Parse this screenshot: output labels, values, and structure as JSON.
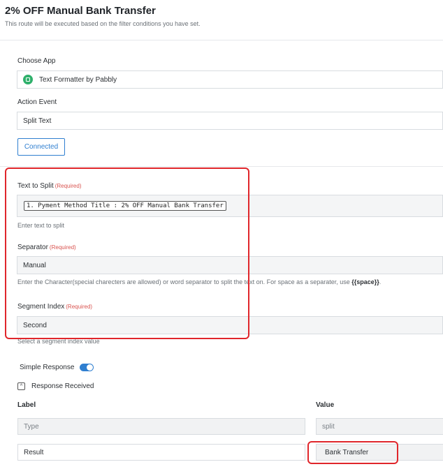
{
  "header": {
    "title": "2% OFF Manual Bank Transfer",
    "subtitle": "This route will be executed based on the filter conditions you have set."
  },
  "choose_app": {
    "label": "Choose App",
    "value": "Text Formatter by Pabbly",
    "icon": "pabbly-formatter-icon"
  },
  "action_event": {
    "label": "Action Event",
    "value": "Split Text"
  },
  "connected_button": "Connected",
  "text_to_split": {
    "label": "Text to Split",
    "required": "(Required)",
    "token": "1. Pyment Method Title : 2% OFF Manual Bank Transfer",
    "help": "Enter text to split"
  },
  "separator": {
    "label": "Separator",
    "required": "(Required)",
    "value": "Manual",
    "help_prefix": "Enter the Character(special charecters are allowed) or word separator to split the text on. For space as a separater, use ",
    "help_code": "{{space}}",
    "help_suffix": "."
  },
  "segment_index": {
    "label": "Segment Index",
    "required": "(Required)",
    "value": "Second",
    "help": "Select a segment index value"
  },
  "simple_response": {
    "label": "Simple Response",
    "enabled": true
  },
  "response_received": {
    "label": "Response Received",
    "collapse_symbol": "^"
  },
  "response_table": {
    "headers": {
      "label": "Label",
      "value": "Value"
    },
    "rows": [
      {
        "label": "Type",
        "value": "split"
      },
      {
        "label": "Result",
        "value": "Bank Transfer"
      }
    ]
  },
  "colors": {
    "accent": "#2f7fd0",
    "required": "#d9534f",
    "highlight": "#e0262b",
    "app_icon": "#2fb06b"
  }
}
